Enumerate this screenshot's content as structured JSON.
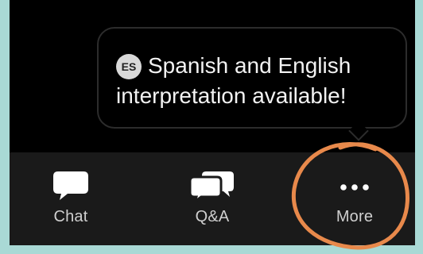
{
  "tooltip": {
    "badge": "ES",
    "line1": "Spanish and English",
    "line2": "interpretation available!"
  },
  "toolbar": {
    "chat_label": "Chat",
    "qa_label": "Q&A",
    "more_label": "More",
    "chat_icon": "chat-bubble-icon",
    "qa_icon": "qa-bubbles-icon",
    "more_icon": "ellipsis-icon"
  },
  "colors": {
    "background": "#a9d9d5",
    "screen": "#000000",
    "toolbar": "#1a1a1a",
    "highlight": "#e8894b"
  }
}
